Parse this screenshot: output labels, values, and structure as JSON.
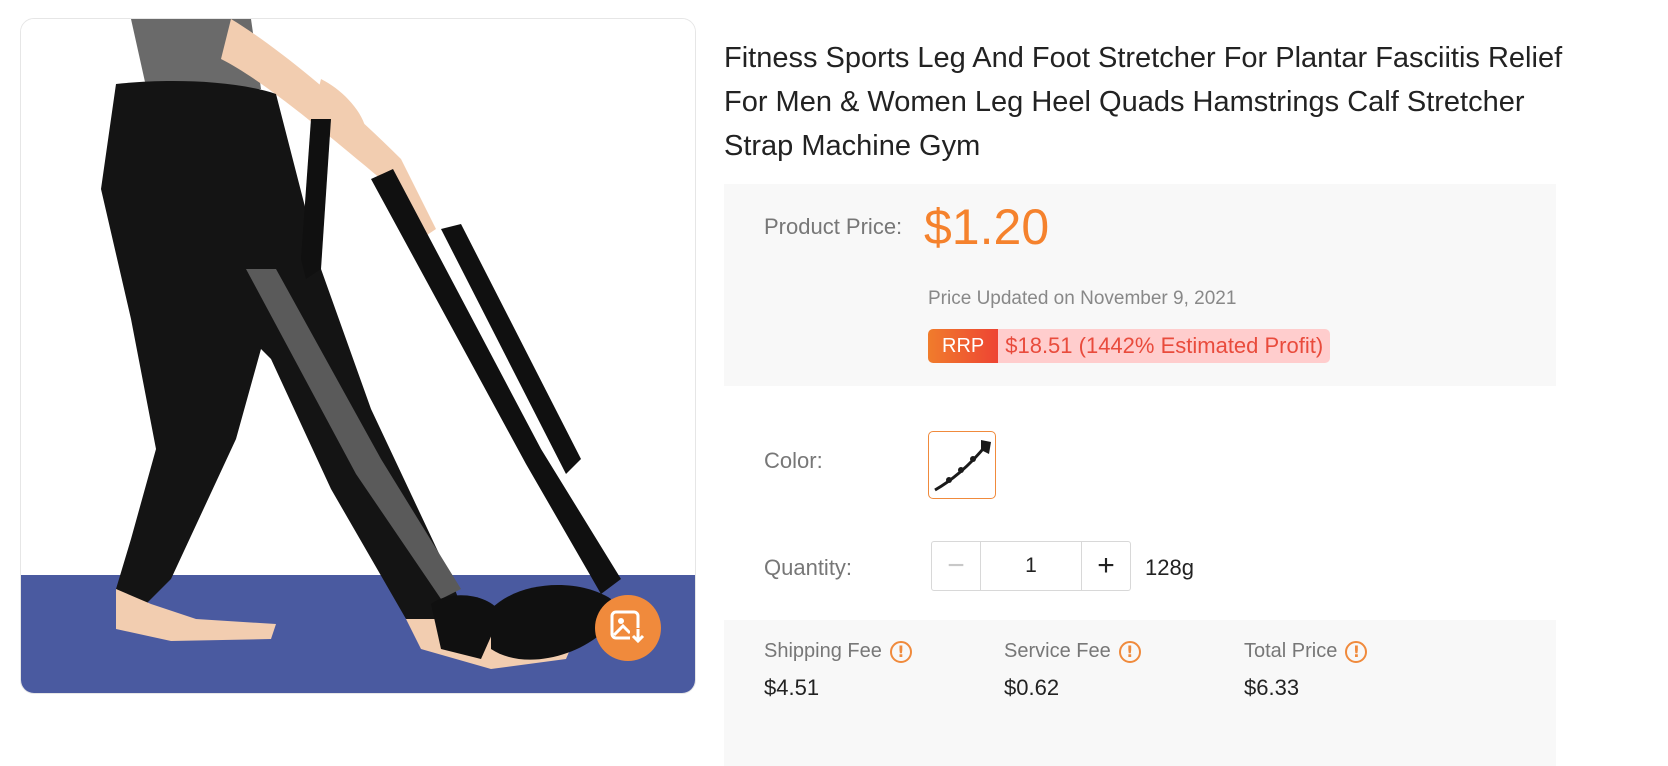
{
  "product": {
    "title": "Fitness Sports Leg And Foot Stretcher For Plantar Fasciitis Relief For Men & Women Leg Heel Quads Hamstrings Calf Stretcher Strap Machine Gym",
    "image_icon": "product-photo",
    "download_icon": "image-download-icon"
  },
  "pricing": {
    "label": "Product Price:",
    "value": "$1.20",
    "updated": "Price Updated on November 9, 2021",
    "rrp_tag": "RRP",
    "rrp_value": "$18.51 (1442% Estimated Profit)"
  },
  "color": {
    "label": "Color:",
    "selected_swatch": "black-strap"
  },
  "quantity": {
    "label": "Quantity:",
    "minus": "−",
    "value": "1",
    "plus": "+",
    "weight": "128g"
  },
  "fees": {
    "shipping": {
      "label": "Shipping Fee",
      "value": "$4.51"
    },
    "service": {
      "label": "Service Fee",
      "value": "$0.62"
    },
    "total": {
      "label": "Total Price",
      "value": "$6.33"
    },
    "info_glyph": "!"
  },
  "colors": {
    "accent": "#f5822d",
    "rrp_text": "#e94b3c",
    "rrp_bg": "#ffcdcd",
    "panel_bg": "#f8f8f8"
  }
}
